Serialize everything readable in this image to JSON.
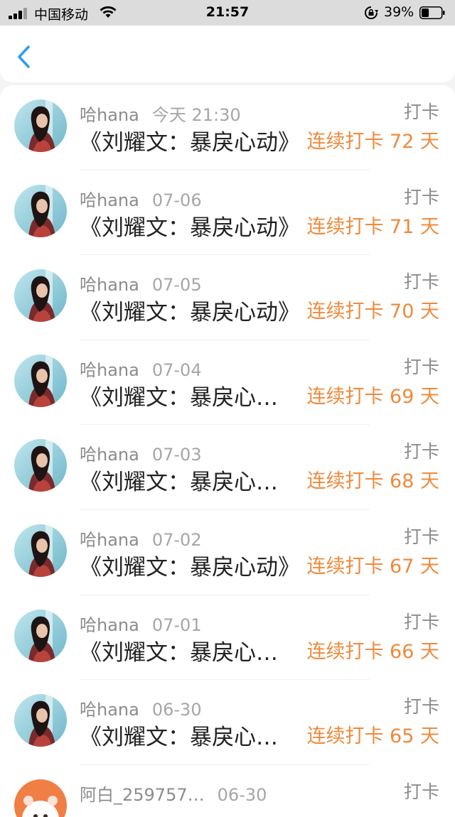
{
  "status_bar": {
    "carrier": "中国移动",
    "time": "21:57",
    "battery_percent": "39%",
    "battery_level": 0.39,
    "signal_icon": "signal-bars-icon",
    "wifi_icon": "wifi-icon",
    "lock_icon": "orientation-lock-icon"
  },
  "header": {
    "back_icon": "chevron-left-icon",
    "accent_color": "#2f9bf0"
  },
  "colors": {
    "streak": "#ef8a3c",
    "username": "#8c8c8c",
    "title": "#222222"
  },
  "list": {
    "items": [
      {
        "username": "哈hana",
        "date": "今天 21:30",
        "tag": "打卡",
        "title": "《刘耀文：暴戾心动》",
        "streak": "连续打卡 72 天",
        "avatar": "photo"
      },
      {
        "username": "哈hana",
        "date": "07-06",
        "tag": "打卡",
        "title": "《刘耀文：暴戾心动》",
        "streak": "连续打卡 71 天",
        "avatar": "photo"
      },
      {
        "username": "哈hana",
        "date": "07-05",
        "tag": "打卡",
        "title": "《刘耀文：暴戾心动》",
        "streak": "连续打卡 70 天",
        "avatar": "photo"
      },
      {
        "username": "哈hana",
        "date": "07-04",
        "tag": "打卡",
        "title": "《刘耀文：暴戾心…",
        "streak": "连续打卡 69 天",
        "avatar": "photo"
      },
      {
        "username": "哈hana",
        "date": "07-03",
        "tag": "打卡",
        "title": "《刘耀文：暴戾心…",
        "streak": "连续打卡 68 天",
        "avatar": "photo"
      },
      {
        "username": "哈hana",
        "date": "07-02",
        "tag": "打卡",
        "title": "《刘耀文：暴戾心动》",
        "streak": "连续打卡 67 天",
        "avatar": "photo"
      },
      {
        "username": "哈hana",
        "date": "07-01",
        "tag": "打卡",
        "title": "《刘耀文：暴戾心…",
        "streak": "连续打卡 66 天",
        "avatar": "photo"
      },
      {
        "username": "哈hana",
        "date": "06-30",
        "tag": "打卡",
        "title": "《刘耀文：暴戾心…",
        "streak": "连续打卡 65 天",
        "avatar": "photo"
      },
      {
        "username": "阿白_259757…",
        "date": "06-30",
        "tag": "打卡",
        "title": "",
        "streak": "",
        "avatar": "cartoon"
      }
    ]
  }
}
